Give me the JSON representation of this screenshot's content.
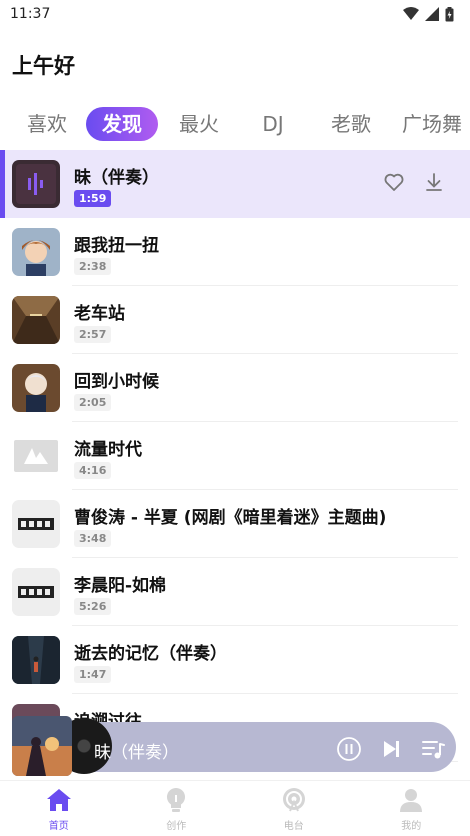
{
  "status_bar": {
    "time": "11:37"
  },
  "header": {
    "greeting": "上午好"
  },
  "tabs": [
    {
      "label": "喜欢"
    },
    {
      "label": "发现",
      "active": true
    },
    {
      "label": "最火"
    },
    {
      "label": "DJ"
    },
    {
      "label": "老歌"
    },
    {
      "label": "广场舞"
    }
  ],
  "songs": [
    {
      "title": "昧（伴奏）",
      "duration": "1:59",
      "playing": true,
      "cover": "purple-wave"
    },
    {
      "title": "跟我扭一扭",
      "duration": "2:38",
      "cover": "boy-avatar"
    },
    {
      "title": "老车站",
      "duration": "2:57",
      "cover": "station"
    },
    {
      "title": "回到小时候",
      "duration": "2:05",
      "cover": "kid"
    },
    {
      "title": "流量时代",
      "duration": "4:16",
      "cover": "logo-a"
    },
    {
      "title": "曹俊涛 - 半夏 (网剧《暗里着迷》主题曲)",
      "duration": "3:48",
      "cover": "text-logo"
    },
    {
      "title": "李晨阳-如棉",
      "duration": "5:26",
      "cover": "text-logo"
    },
    {
      "title": "逝去的记忆（伴奏）",
      "duration": "1:47",
      "cover": "alley"
    },
    {
      "title": "追溯过往",
      "duration": "",
      "cover": "dusk"
    }
  ],
  "mini_player": {
    "title": "昧（伴奏）"
  },
  "bottom_nav": [
    {
      "label": "首页",
      "icon": "home-icon",
      "active": true
    },
    {
      "label": "创作",
      "icon": "lightbulb-icon"
    },
    {
      "label": "电台",
      "icon": "radio-icon"
    },
    {
      "label": "我的",
      "icon": "user-icon"
    }
  ],
  "colors": {
    "accent": "#6a4cf0",
    "accent_end": "#b05cf0",
    "playing_bg": "#ebe6fb"
  }
}
